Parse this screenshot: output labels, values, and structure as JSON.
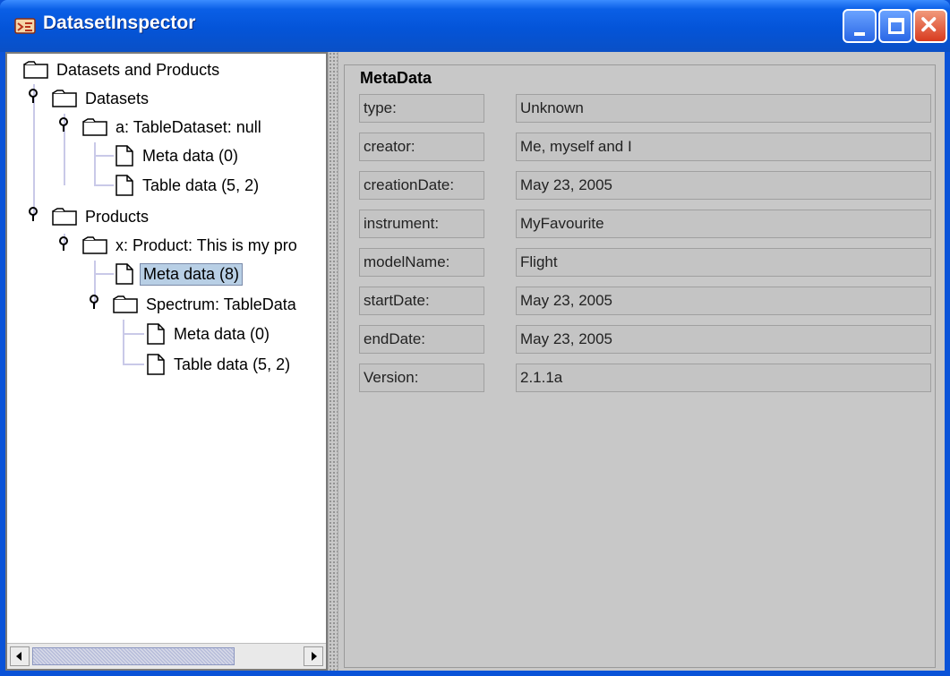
{
  "window": {
    "title": "DatasetInspector",
    "buttons": [
      "minimize",
      "maximize",
      "close"
    ]
  },
  "tree": {
    "root": "Datasets and Products",
    "nodes": [
      {
        "label": "Datasets"
      },
      {
        "label": "a: TableDataset: null"
      },
      {
        "label": "Meta data (0)"
      },
      {
        "label": "Table data (5, 2)"
      },
      {
        "label": "Products"
      },
      {
        "label": "x: Product: This is my pro"
      },
      {
        "label": "Meta data (8)",
        "selected": true
      },
      {
        "label": "Spectrum: TableData"
      },
      {
        "label": "Meta data (0)"
      },
      {
        "label": "Table data (5, 2)"
      }
    ]
  },
  "metadata": {
    "title": "MetaData",
    "rows": [
      {
        "key": "type:",
        "value": "Unknown"
      },
      {
        "key": "creator:",
        "value": "Me, myself and I"
      },
      {
        "key": "creationDate:",
        "value": "May 23, 2005"
      },
      {
        "key": "instrument:",
        "value": "MyFavourite"
      },
      {
        "key": "modelName:",
        "value": "Flight"
      },
      {
        "key": "startDate:",
        "value": "May 23, 2005"
      },
      {
        "key": "endDate:",
        "value": "May 23, 2005"
      },
      {
        "key": "Version:",
        "value": "2.1.1a"
      }
    ]
  },
  "colors": {
    "titlebar": "#0454d8",
    "selection": "#b8cfe5",
    "panel": "#c8c8c8"
  }
}
